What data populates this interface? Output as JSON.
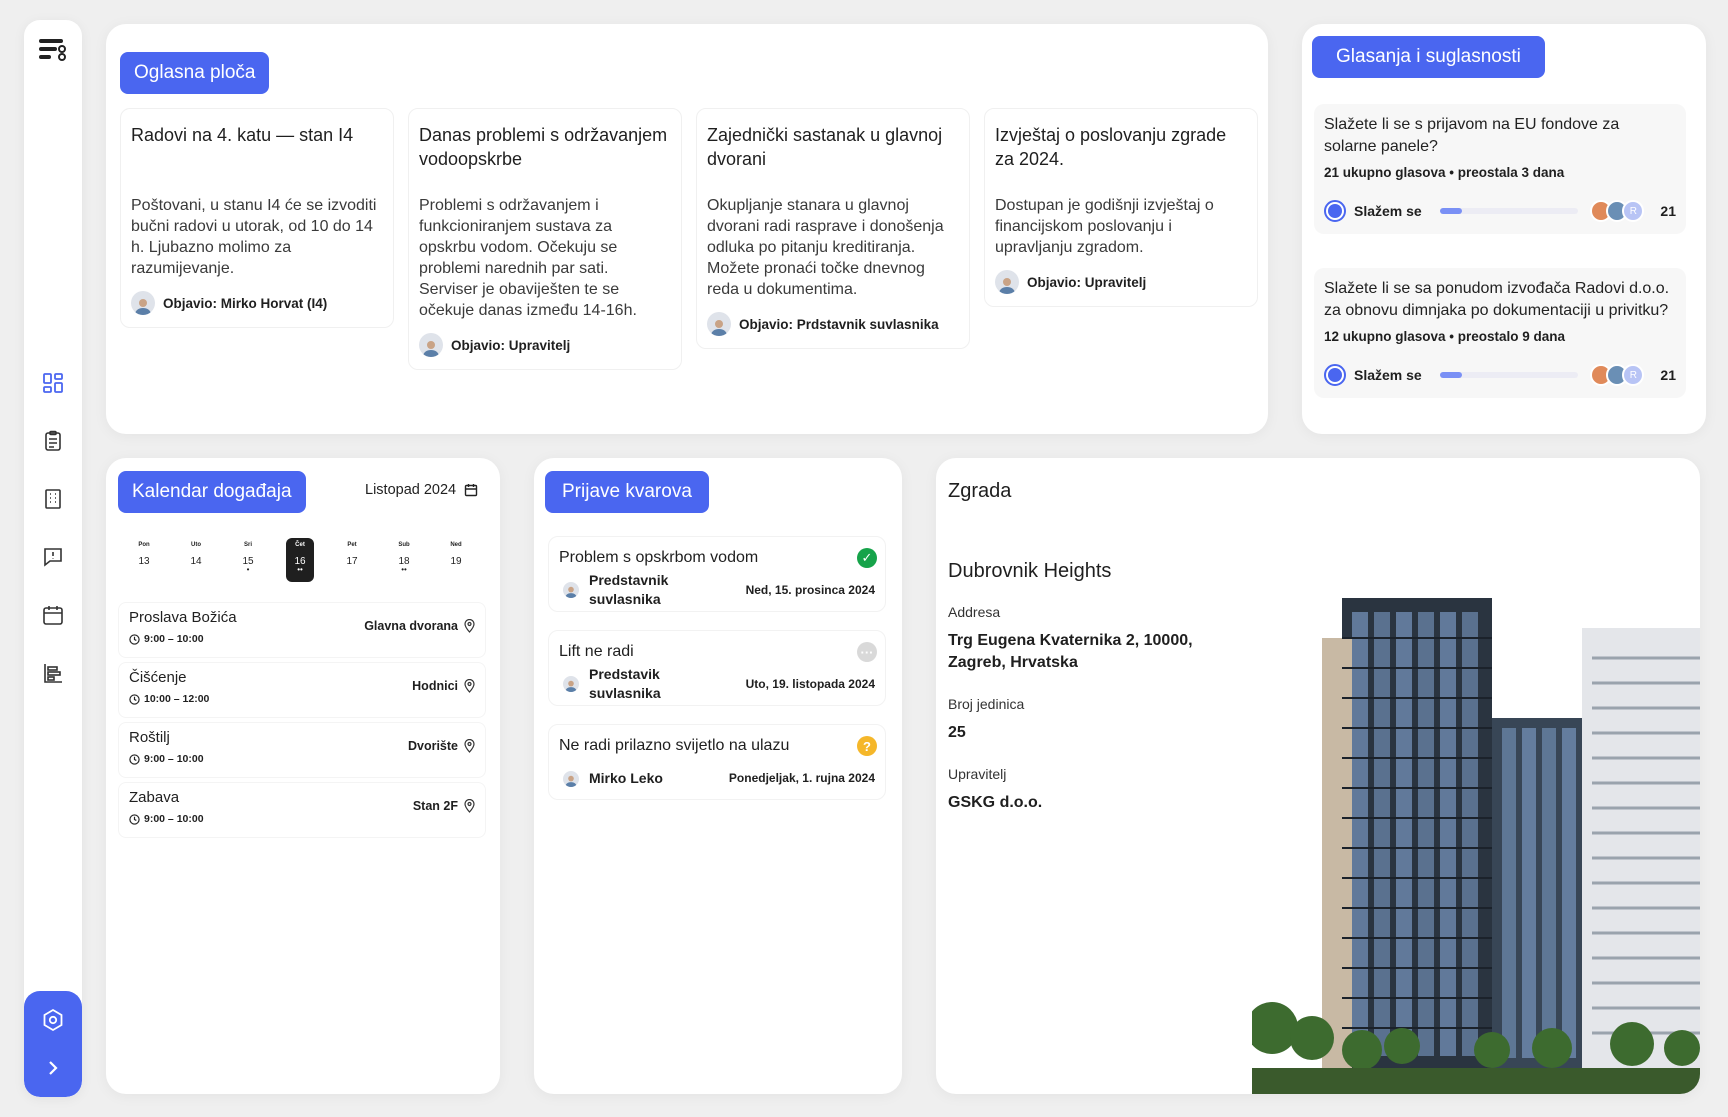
{
  "sidebar": {
    "icons": [
      "logo-icon",
      "dashboard-icon",
      "clipboard-icon",
      "building-icon",
      "message-icon",
      "calendar-icon",
      "chart-icon"
    ],
    "bottom_icons": [
      "settings-icon",
      "chevron-right-icon"
    ]
  },
  "notice_board": {
    "title": "Oglasna ploča",
    "items": [
      {
        "title": "Radovi na 4. katu — stan I4",
        "body": "Poštovani, u stanu I4 će se izvoditi bučni radovi u utorak, od 10 do 14 h. Ljubazno molimo za razumijevanje.",
        "author": "Objavio: Mirko Horvat (I4)"
      },
      {
        "title": "Danas problemi s održavanjem vodoopskrbe",
        "body": "Problemi s održavanjem i funkcioniranjem sustava za opskrbu vodom. Očekuju se problemi narednih par sati. Serviser je obaviješten te se očekuje danas između 14-16h.",
        "author": "Objavio: Upravitelj"
      },
      {
        "title": "Zajednički sastanak u glavnoj dvorani",
        "body": "Okupljanje stanara u glavnoj dvorani radi rasprave i donošenja odluka po pitanju kreditiranja. Možete pronaći točke dnevnog reda u dokumentima.",
        "author": "Objavio: Prdstavnik suvlasnika"
      },
      {
        "title": "Izvještaj o poslovanju zgrade za 2024.",
        "body": "Dostupan je godišnji izvještaj o financijskom poslovanju i upravljanju zgradom.",
        "author": "Objavio: Upravitelj"
      }
    ]
  },
  "polls": {
    "title": "Glasanja i suglasnosti",
    "items": [
      {
        "question": "Slažete li se s prijavom na EU fondove za solarne panele?",
        "meta": "21 ukupno glasova • preostala 3 dana",
        "option": "Slažem se",
        "progress": 0.16,
        "count": "21",
        "avatar_letter": "R"
      },
      {
        "question": "Slažete li se sa ponudom izvođača Radovi d.o.o. za obnovu dimnjaka po dokumentaciji u privitku?",
        "meta": "12 ukupno glasova • preostalo 9 dana",
        "option": "Slažem se",
        "progress": 0.16,
        "count": "21",
        "avatar_letter": "R"
      }
    ]
  },
  "calendar": {
    "title": "Kalendar događaja",
    "month": "Listopad 2024",
    "days": [
      {
        "name": "Pon",
        "num": "13",
        "dots": ""
      },
      {
        "name": "Uto",
        "num": "14",
        "dots": ""
      },
      {
        "name": "Sri",
        "num": "15",
        "dots": "•"
      },
      {
        "name": "Čet",
        "num": "16",
        "dots": "••",
        "selected": true
      },
      {
        "name": "Pet",
        "num": "17",
        "dots": ""
      },
      {
        "name": "Sub",
        "num": "18",
        "dots": "••"
      },
      {
        "name": "Ned",
        "num": "19",
        "dots": ""
      }
    ],
    "events": [
      {
        "title": "Proslava Božića",
        "time": "9:00 – 10:00",
        "location": "Glavna dvorana"
      },
      {
        "title": "Čišćenje",
        "time": "10:00 – 12:00",
        "location": "Hodnici"
      },
      {
        "title": "Roštilj",
        "time": "9:00 – 10:00",
        "location": "Dvorište"
      },
      {
        "title": "Zabava",
        "time": "9:00 – 10:00",
        "location": "Stan 2F"
      }
    ]
  },
  "faults": {
    "title": "Prijave kvarova",
    "items": [
      {
        "title": "Problem s opskrbom vodom",
        "reporter": "Predstavnik suvlasnika",
        "date": "Ned, 15. prosinca 2024",
        "status": "resolved",
        "status_color": "#16a34a"
      },
      {
        "title": "Lift ne radi",
        "reporter": "Predstavik suvlasnika",
        "date": "Uto, 19. listopada 2024",
        "status": "pending",
        "status_color": "#d4d4d4"
      },
      {
        "title": "Ne radi prilazno svijetlo na ulazu",
        "reporter": "Mirko Leko",
        "date": "Ponedjeljak, 1. rujna 2024",
        "status": "unknown",
        "status_color": "#f5b72a"
      }
    ]
  },
  "building": {
    "section_title": "Zgrada",
    "name": "Dubrovnik Heights",
    "address_label": "Addresa",
    "address": "Trg Eugena Kvaternika 2, 10000, Zagreb, Hrvatska",
    "units_label": "Broj jedinica",
    "units": "25",
    "manager_label": "Upravitelj",
    "manager": "GSKG d.o.o."
  },
  "colors": {
    "accent": "#4a66f0",
    "background": "#efefef",
    "card": "#ffffff"
  }
}
